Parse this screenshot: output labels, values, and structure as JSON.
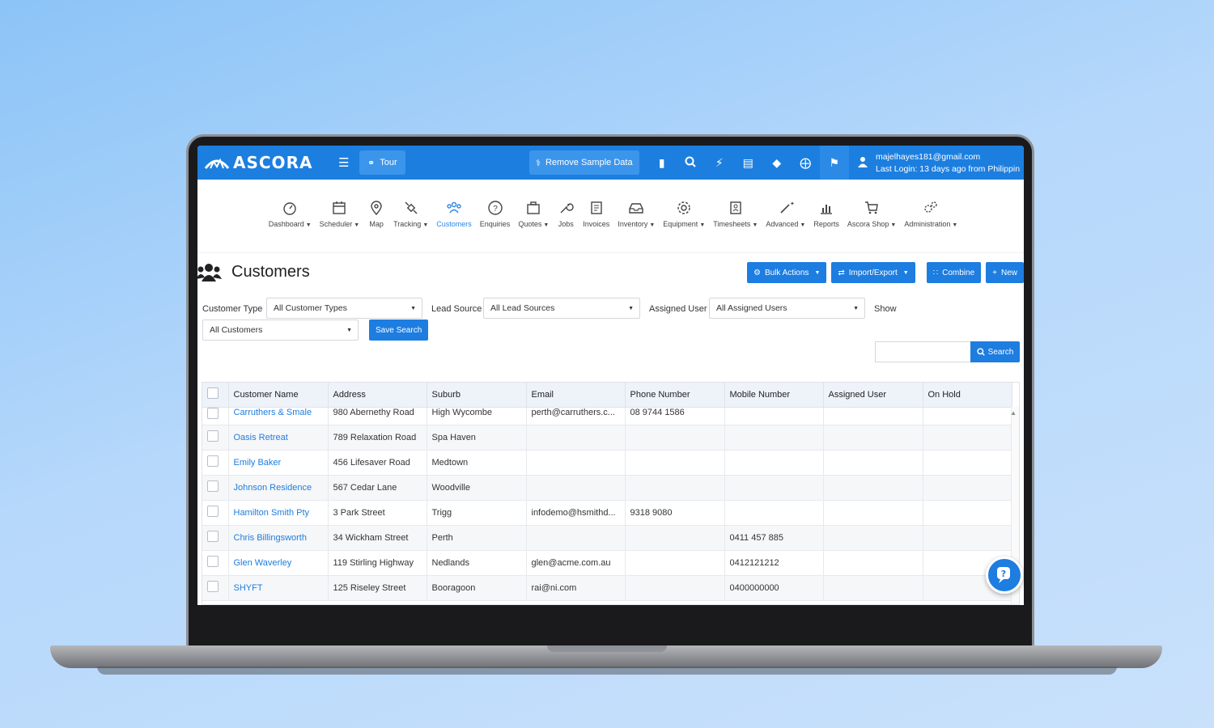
{
  "app": {
    "logo_text": "ASCORA",
    "tour_label": "Tour",
    "remove_sample_label": "Remove Sample Data",
    "user_email": "majelhayes181@gmail.com",
    "last_login": "Last Login: 13 days ago from Philippin"
  },
  "nav": [
    {
      "label": "Dashboard",
      "icon": "gauge-icon",
      "caret": true
    },
    {
      "label": "Scheduler",
      "icon": "calendar-icon",
      "caret": true
    },
    {
      "label": "Map",
      "icon": "map-pin-icon",
      "caret": false
    },
    {
      "label": "Tracking",
      "icon": "satellite-icon",
      "caret": true
    },
    {
      "label": "Customers",
      "icon": "users-icon",
      "caret": false,
      "active": true
    },
    {
      "label": "Enquiries",
      "icon": "question-icon",
      "caret": false
    },
    {
      "label": "Quotes",
      "icon": "briefcase-icon",
      "caret": true
    },
    {
      "label": "Jobs",
      "icon": "wrench-icon",
      "caret": false
    },
    {
      "label": "Invoices",
      "icon": "invoice-icon",
      "caret": false
    },
    {
      "label": "Inventory",
      "icon": "inbox-icon",
      "caret": true
    },
    {
      "label": "Equipment",
      "icon": "gear-icon",
      "caret": true
    },
    {
      "label": "Timesheets",
      "icon": "timesheet-icon",
      "caret": true
    },
    {
      "label": "Advanced",
      "icon": "magic-wand-icon",
      "caret": true
    },
    {
      "label": "Reports",
      "icon": "bar-chart-icon",
      "caret": false
    },
    {
      "label": "Ascora Shop",
      "icon": "cart-icon",
      "caret": true
    },
    {
      "label": "Administration",
      "icon": "gears-icon",
      "caret": true
    }
  ],
  "page": {
    "title": "Customers",
    "bulk_actions": "Bulk Actions",
    "import_export": "Import/Export",
    "combine": "Combine",
    "new": "New"
  },
  "filters": {
    "customer_type_label": "Customer Type",
    "customer_type_value": "All Customer Types",
    "lead_source_label": "Lead Source",
    "lead_source_value": "All Lead Sources",
    "assigned_user_label": "Assigned User",
    "assigned_user_value": "All Assigned Users",
    "show_label": "Show",
    "show_value": "All Customers",
    "save_search": "Save Search",
    "search_button": "Search",
    "search_value": ""
  },
  "table": {
    "columns": [
      "Customer Name",
      "Address",
      "Suburb",
      "Email",
      "Phone Number",
      "Mobile Number",
      "Assigned User",
      "On Hold"
    ],
    "rows": [
      [
        "Carruthers & Smale",
        "980 Abernethy Road",
        "High Wycombe",
        "perth@carruthers.c...",
        "08 9744 1586",
        "",
        "",
        ""
      ],
      [
        "Oasis Retreat",
        "789 Relaxation Road",
        "Spa Haven",
        "",
        "",
        "",
        "",
        ""
      ],
      [
        "Emily Baker",
        "456 Lifesaver Road",
        "Medtown",
        "",
        "",
        "",
        "",
        ""
      ],
      [
        "Johnson Residence",
        "567 Cedar Lane",
        "Woodville",
        "",
        "",
        "",
        "",
        ""
      ],
      [
        "Hamilton Smith Pty",
        "3 Park Street",
        "Trigg",
        "infodemo@hsmithd...",
        "9318 9080",
        "",
        "",
        ""
      ],
      [
        "Chris Billingsworth",
        "34 Wickham Street",
        "Perth",
        "",
        "",
        "0411 457 885",
        "",
        ""
      ],
      [
        "Glen Waverley",
        "119 Stirling Highway",
        "Nedlands",
        "glen@acme.com.au",
        "",
        "0412121212",
        "",
        ""
      ],
      [
        "SHYFT",
        "125 Riseley Street",
        "Booragoon",
        "rai@ni.com",
        "",
        "0400000000",
        "",
        ""
      ]
    ]
  },
  "colors": {
    "primary": "#1c7fe0",
    "link": "#1d7de0"
  }
}
